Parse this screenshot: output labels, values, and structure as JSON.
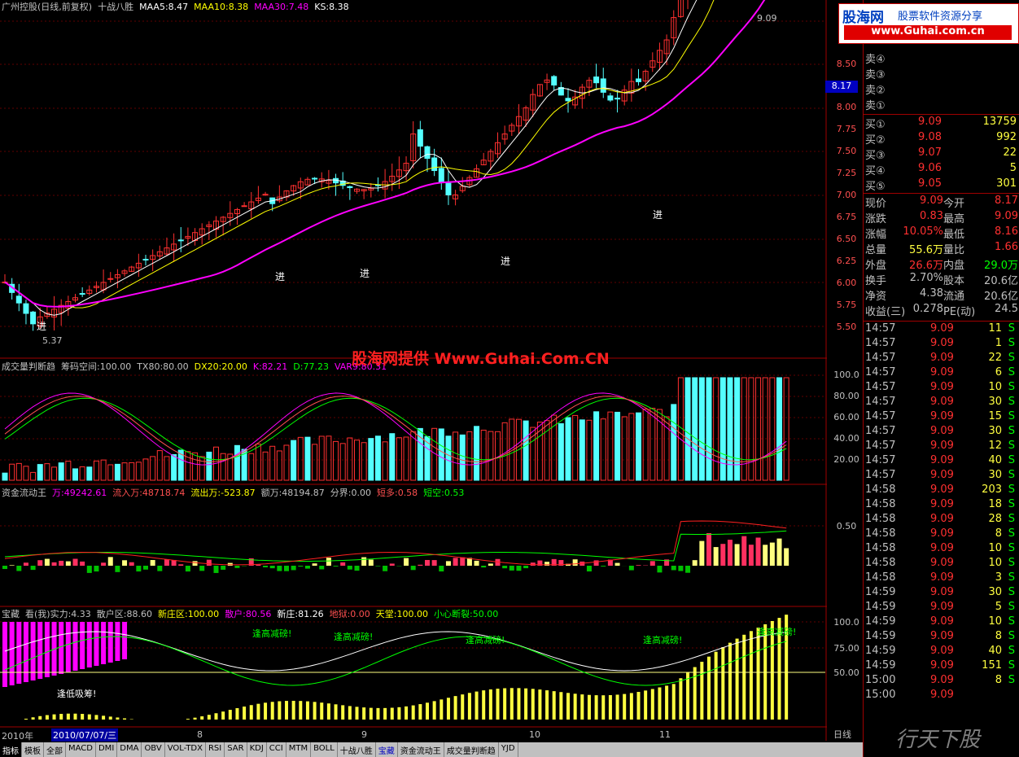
{
  "kline_title": [
    "广州控股(日线,前复权)",
    "十战八胜",
    "MAA5:8.47",
    "MAA10:8.38",
    "MAA30:7.48",
    "KS:8.38"
  ],
  "kline_title_colors": [
    "#c0c0c0",
    "#c0c0c0",
    "#ffffff",
    "#ffff00",
    "#ff00ff",
    "#ffffff"
  ],
  "price_axis": [
    "8.50",
    "8.25",
    "8.00",
    "7.75",
    "7.50",
    "7.25",
    "7.00",
    "6.75",
    "6.50",
    "6.25",
    "6.00",
    "5.75",
    "5.50"
  ],
  "current_price_tag": "8.17",
  "high_label": "9.09",
  "low_label": "5.37",
  "entry_marks": [
    "进",
    "进",
    "进",
    "进",
    "进"
  ],
  "panel2_title": [
    "成交量判断趋",
    "筹码空间:100.00",
    "TX80:80.00",
    "DX20:20.00",
    "K:82.21",
    "D:77.23",
    "VAR9:80.31"
  ],
  "panel2_title_colors": [
    "#c0c0c0",
    "#c0c0c0",
    "#c0c0c0",
    "#ffff00",
    "#ff00ff",
    "#00ff00",
    "#ff00ff"
  ],
  "panel2_axis": [
    "100.0",
    "80.00",
    "60.00",
    "40.00",
    "20.00"
  ],
  "watermark": "股海网提供 Www.Guhai.Com.CN",
  "panel3_title": [
    "资金流动王",
    "万:49242.61",
    "流入万:48718.74",
    "流出万:-523.87",
    "额万:48194.87",
    "分界:0.00",
    "短多:0.58",
    "短空:0.53"
  ],
  "panel3_title_colors": [
    "#c0c0c0",
    "#ff00ff",
    "#ff5050",
    "#ffff00",
    "#c0c0c0",
    "#c0c0c0",
    "#ff5050",
    "#00ff00"
  ],
  "panel3_axis": [
    "0.50"
  ],
  "panel4_title": [
    "宝藏",
    "看(我)实力:4.33",
    "散户区:88.60",
    "新庄区:100.00",
    "散户:80.56",
    "新庄:81.26",
    "地狱:0.00",
    "天堂:100.00",
    "小心断裂:50.00"
  ],
  "panel4_title_colors": [
    "#c0c0c0",
    "#c0c0c0",
    "#c0c0c0",
    "#ffff00",
    "#ff00ff",
    "#ffffff",
    "#ff5050",
    "#ffff00",
    "#00ff00"
  ],
  "panel4_axis": [
    "100.0",
    "75.00",
    "50.00"
  ],
  "panel4_notes": [
    "逢高减磅!",
    "逢高减磅!",
    "逢高减磅!",
    "逢高减磅!",
    "逢高减磅!",
    "逢低吸筹!"
  ],
  "date_axis": [
    "2010年",
    "2010/07/07/三",
    "8",
    "9",
    "10",
    "11"
  ],
  "timeframe": "日线",
  "logo": {
    "title": "股海网",
    "subtitle": "股票软件资源分享",
    "url": "www.Guhai.com.cn"
  },
  "bottom_logo": "行天下股",
  "sell_orders": [
    {
      "label": "卖④",
      "price": "",
      "vol": ""
    },
    {
      "label": "卖③",
      "price": "",
      "vol": ""
    },
    {
      "label": "卖②",
      "price": "",
      "vol": ""
    },
    {
      "label": "卖①",
      "price": "",
      "vol": ""
    }
  ],
  "buy_orders": [
    {
      "label": "买①",
      "price": "9.09",
      "vol": "13759"
    },
    {
      "label": "买②",
      "price": "9.08",
      "vol": "992"
    },
    {
      "label": "买③",
      "price": "9.07",
      "vol": "22"
    },
    {
      "label": "买④",
      "price": "9.06",
      "vol": "5"
    },
    {
      "label": "买⑤",
      "price": "9.05",
      "vol": "301"
    }
  ],
  "stats": [
    {
      "k1": "现价",
      "v1": "9.09",
      "c1": "#ff3030",
      "k2": "今开",
      "v2": "8.17",
      "c2": "#ff3030"
    },
    {
      "k1": "涨跌",
      "v1": "0.83",
      "c1": "#ff3030",
      "k2": "最高",
      "v2": "9.09",
      "c2": "#ff3030"
    },
    {
      "k1": "涨幅",
      "v1": "10.05%",
      "c1": "#ff3030",
      "k2": "最低",
      "v2": "8.16",
      "c2": "#ff3030"
    },
    {
      "k1": "总量",
      "v1": "55.6万",
      "c1": "#ffff40",
      "k2": "量比",
      "v2": "1.66",
      "c2": "#ff3030"
    },
    {
      "k1": "外盘",
      "v1": "26.6万",
      "c1": "#ff3030",
      "k2": "内盘",
      "v2": "29.0万",
      "c2": "#00ff00"
    },
    {
      "k1": "换手",
      "v1": "2.70%",
      "c1": "#c0c0c0",
      "k2": "股本",
      "v2": "20.6亿",
      "c2": "#c0c0c0"
    },
    {
      "k1": "净资",
      "v1": "4.38",
      "c1": "#c0c0c0",
      "k2": "流通",
      "v2": "20.6亿",
      "c2": "#c0c0c0"
    },
    {
      "k1": "收益(三)",
      "v1": "0.278",
      "c1": "#c0c0c0",
      "k2": "PE(动)",
      "v2": "24.5",
      "c2": "#c0c0c0"
    }
  ],
  "ticks": [
    {
      "t": "14:57",
      "p": "9.09",
      "v": "11",
      "s": "S"
    },
    {
      "t": "14:57",
      "p": "9.09",
      "v": "1",
      "s": "S"
    },
    {
      "t": "14:57",
      "p": "9.09",
      "v": "22",
      "s": "S"
    },
    {
      "t": "14:57",
      "p": "9.09",
      "v": "6",
      "s": "S"
    },
    {
      "t": "14:57",
      "p": "9.09",
      "v": "10",
      "s": "S"
    },
    {
      "t": "14:57",
      "p": "9.09",
      "v": "30",
      "s": "S"
    },
    {
      "t": "14:57",
      "p": "9.09",
      "v": "15",
      "s": "S"
    },
    {
      "t": "14:57",
      "p": "9.09",
      "v": "30",
      "s": "S"
    },
    {
      "t": "14:57",
      "p": "9.09",
      "v": "12",
      "s": "S"
    },
    {
      "t": "14:57",
      "p": "9.09",
      "v": "40",
      "s": "S"
    },
    {
      "t": "14:57",
      "p": "9.09",
      "v": "30",
      "s": "S"
    },
    {
      "t": "14:58",
      "p": "9.09",
      "v": "203",
      "s": "S"
    },
    {
      "t": "14:58",
      "p": "9.09",
      "v": "18",
      "s": "S"
    },
    {
      "t": "14:58",
      "p": "9.09",
      "v": "28",
      "s": "S"
    },
    {
      "t": "14:58",
      "p": "9.09",
      "v": "8",
      "s": "S"
    },
    {
      "t": "14:58",
      "p": "9.09",
      "v": "10",
      "s": "S"
    },
    {
      "t": "14:58",
      "p": "9.09",
      "v": "10",
      "s": "S"
    },
    {
      "t": "14:58",
      "p": "9.09",
      "v": "3",
      "s": "S"
    },
    {
      "t": "14:59",
      "p": "9.09",
      "v": "30",
      "s": "S"
    },
    {
      "t": "14:59",
      "p": "9.09",
      "v": "5",
      "s": "S"
    },
    {
      "t": "14:59",
      "p": "9.09",
      "v": "10",
      "s": "S"
    },
    {
      "t": "14:59",
      "p": "9.09",
      "v": "8",
      "s": "S"
    },
    {
      "t": "14:59",
      "p": "9.09",
      "v": "40",
      "s": "S"
    },
    {
      "t": "14:59",
      "p": "9.09",
      "v": "151",
      "s": "S"
    },
    {
      "t": "15:00",
      "p": "9.09",
      "v": "8",
      "s": "S"
    },
    {
      "t": "15:00",
      "p": "9.09",
      "v": "",
      "s": ""
    }
  ],
  "tabs": [
    "指标",
    "模板",
    "全部",
    "MACD",
    "DMI",
    "DMA",
    "OBV",
    "VOL-TDX",
    "RSI",
    "SAR",
    "KDJ",
    "CCI",
    "MTM",
    "BOLL",
    "十战八胜",
    "宝藏",
    "资金流动王",
    "成交量判断趋",
    "YJD"
  ],
  "active_tab": 0,
  "highlight_tab": 15
}
